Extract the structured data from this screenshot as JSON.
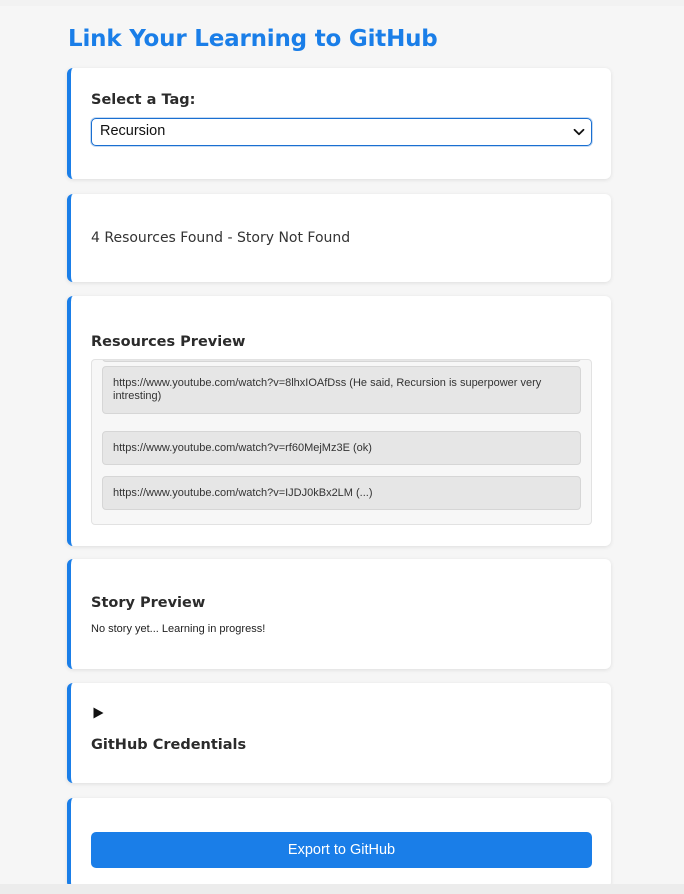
{
  "header": {
    "title": "Link Your Learning to GitHub"
  },
  "tag_section": {
    "label": "Select a Tag:",
    "selected_value": "Recursion",
    "chevron_icon": "chevron-down-icon"
  },
  "status": {
    "text": "4 Resources Found - Story Not Found"
  },
  "resources": {
    "title": "Resources Preview",
    "items": [
      "https://www.youtube.com/watch?v=8lhxIOAfDss (He said, Recursion is superpower very intresting)",
      "https://www.youtube.com/watch?v=rf60MejMz3E (ok)",
      "https://www.youtube.com/watch?v=IJDJ0kBx2LM (...)"
    ]
  },
  "story": {
    "title": "Story Preview",
    "text": "No story yet... Learning in progress!"
  },
  "credentials": {
    "toggle_icon": "disclosure-triangle-icon",
    "title": "GitHub Credentials"
  },
  "export": {
    "button_label": "Export to GitHub"
  },
  "colors": {
    "accent": "#1a7ee8"
  }
}
